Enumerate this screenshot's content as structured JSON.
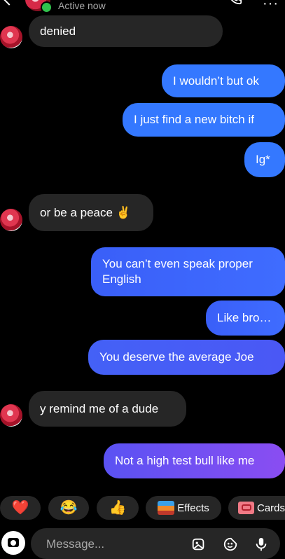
{
  "header": {
    "status": "Active now",
    "call_icon": "phone-icon",
    "more_icon": "more-icon",
    "more_glyph": "···"
  },
  "messages": [
    {
      "side": "in",
      "text": "denied"
    },
    {
      "side": "out",
      "text": "I wouldn’t but ok"
    },
    {
      "side": "out",
      "text": "I just find a new bitch if"
    },
    {
      "side": "out",
      "text": "Ig*"
    },
    {
      "side": "in",
      "text": "or be a peace ✌️"
    },
    {
      "side": "out",
      "text": "You can’t even speak proper English"
    },
    {
      "side": "out",
      "text": "Like bro…"
    },
    {
      "side": "out",
      "text": "You deserve the average Joe"
    },
    {
      "side": "in",
      "text": "y remind me of a dude"
    },
    {
      "side": "out",
      "text": "Not a high test bull like me"
    }
  ],
  "quick_reactions": [
    "❤️",
    "😂",
    "👍"
  ],
  "effects_label": "Effects",
  "cards_label": "Cards",
  "composer": {
    "placeholder": "Message...",
    "icons": [
      "camera-icon",
      "image-icon",
      "sticker-icon",
      "microphone-icon"
    ]
  },
  "colors": {
    "background": "#000000",
    "incoming_bubble": "#262626",
    "outgoing_bubble": "#3478ff",
    "outgoing_gradient_end": "#8a4df2",
    "online": "#31c24d"
  }
}
